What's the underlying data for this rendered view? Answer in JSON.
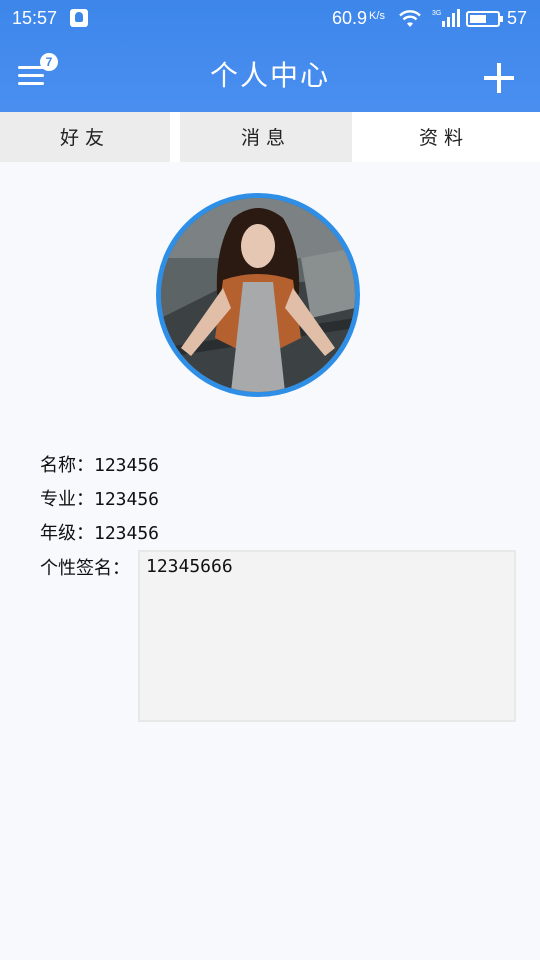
{
  "status_bar": {
    "time": "15:57",
    "speed": "60.9",
    "speed_unit": "K/s",
    "signal_type": "3G",
    "battery": "57"
  },
  "header": {
    "title": "个人中心",
    "menu_badge": "7",
    "menu_icon": "menu-icon",
    "add_icon": "plus-icon"
  },
  "tabs": [
    {
      "label": "好友",
      "active": false
    },
    {
      "label": "消息",
      "active": false
    },
    {
      "label": "资料",
      "active": true
    }
  ],
  "profile": {
    "name_label": "名称：",
    "name_value": "123456",
    "major_label": "专业：",
    "major_value": "123456",
    "grade_label": "年级：",
    "grade_value": "123456",
    "signature_label": "个性签名：",
    "signature_value": "12345666"
  },
  "colors": {
    "header_blue": "#3d86ea",
    "avatar_ring": "#2f8fe6",
    "tab_inactive": "#ececec",
    "background": "#f7f9fc"
  }
}
